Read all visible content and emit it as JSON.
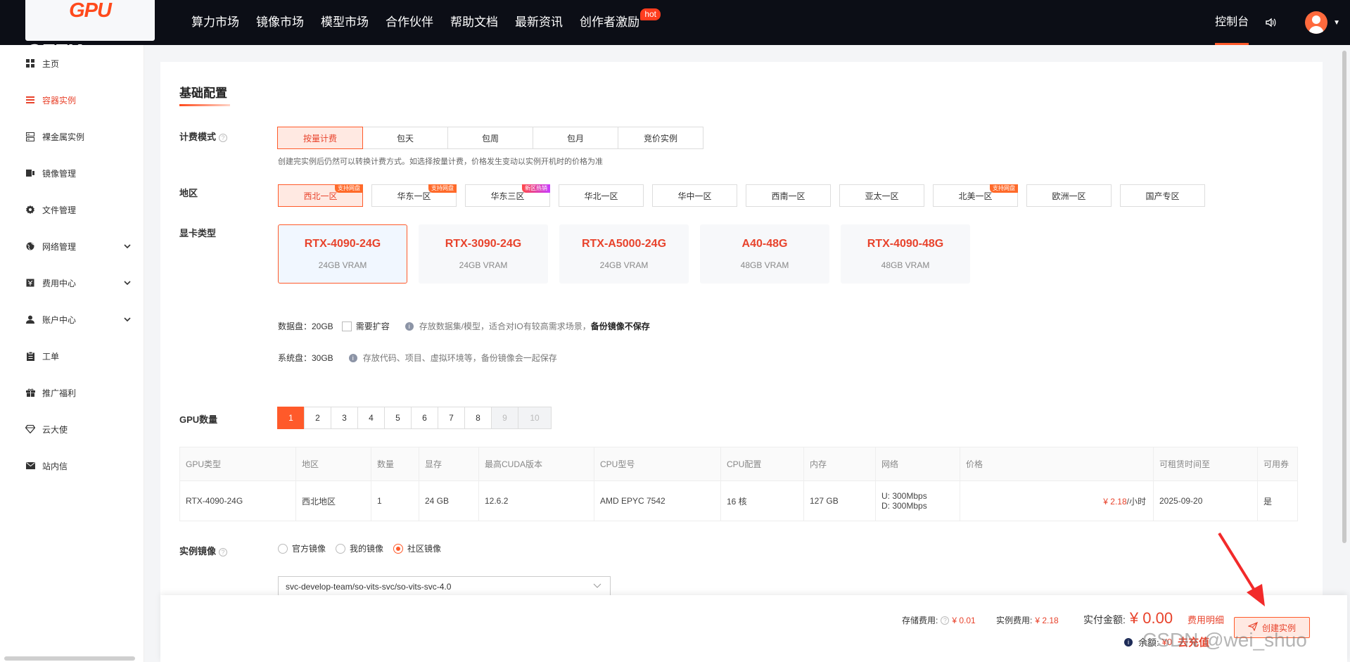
{
  "header": {
    "logo_a": "GPU",
    "logo_b": "GEEK",
    "logo_dot": ".",
    "nav": [
      "算力市场",
      "镜像市场",
      "模型市场",
      "合作伙伴",
      "帮助文档",
      "最新资讯",
      "创作者激励"
    ],
    "hot_badge": "hot",
    "console": "控制台"
  },
  "sidebar": {
    "items": [
      {
        "label": "主页",
        "icon": "grid-icon"
      },
      {
        "label": "容器实例",
        "icon": "list-icon",
        "active": true
      },
      {
        "label": "裸金属实例",
        "icon": "server-icon"
      },
      {
        "label": "镜像管理",
        "icon": "image-icon"
      },
      {
        "label": "文件管理",
        "icon": "gear-icon"
      },
      {
        "label": "网络管理",
        "icon": "globe-icon",
        "expand": true
      },
      {
        "label": "费用中心",
        "icon": "wallet-icon",
        "expand": true
      },
      {
        "label": "账户中心",
        "icon": "user-icon",
        "expand": true
      },
      {
        "label": "工单",
        "icon": "clipboard-icon"
      },
      {
        "label": "推广福利",
        "icon": "gift-icon"
      },
      {
        "label": "云大使",
        "icon": "diamond-icon"
      },
      {
        "label": "站内信",
        "icon": "mail-icon"
      }
    ]
  },
  "config": {
    "title": "基础配置",
    "billing": {
      "label": "计费模式",
      "options": [
        "按量计费",
        "包天",
        "包周",
        "包月",
        "竞价实例"
      ],
      "selected": 0,
      "hint": "创建完实例后仍然可以转换计费方式。如选择按量计费，价格发生变动以实例开机时的价格为准"
    },
    "region": {
      "label": "地区",
      "options": [
        {
          "name": "西北一区",
          "tag": "支持网盘",
          "sel": true
        },
        {
          "name": "华东一区",
          "tag": "支持网盘"
        },
        {
          "name": "华东三区",
          "tag": "新区热销",
          "purple": true
        },
        {
          "name": "华北一区"
        },
        {
          "name": "华中一区"
        },
        {
          "name": "西南一区"
        },
        {
          "name": "亚太一区"
        },
        {
          "name": "北美一区",
          "tag": "支持网盘"
        },
        {
          "name": "欧洲一区"
        },
        {
          "name": "国产专区"
        }
      ]
    },
    "gpu": {
      "label": "显卡类型",
      "cards": [
        {
          "name": "RTX-4090-24G",
          "vram": "24GB VRAM",
          "sel": true
        },
        {
          "name": "RTX-3090-24G",
          "vram": "24GB VRAM"
        },
        {
          "name": "RTX-A5000-24G",
          "vram": "24GB VRAM"
        },
        {
          "name": "A40-48G",
          "vram": "48GB VRAM"
        },
        {
          "name": "RTX-4090-48G",
          "vram": "48GB VRAM"
        }
      ]
    },
    "data_disk": {
      "label": "数据盘：20GB",
      "expand": "需要扩容",
      "note": "存放数据集/模型，适合对IO有较高需求场景，",
      "note_bold": "备份镜像不保存"
    },
    "sys_disk": {
      "label": "系统盘：30GB",
      "note": "存放代码、项目、虚拟环境等，备份镜像会一起保存"
    },
    "gpu_count": {
      "label": "GPU数量",
      "options": [
        "1",
        "2",
        "3",
        "4",
        "5",
        "6",
        "7",
        "8",
        "9",
        "10"
      ],
      "selected": "1",
      "disabled": [
        "9",
        "10"
      ]
    },
    "table": {
      "headers": [
        "GPU类型",
        "地区",
        "数量",
        "显存",
        "最高CUDA版本",
        "CPU型号",
        "CPU配置",
        "内存",
        "网络",
        "价格",
        "可租赁时间至",
        "可用券"
      ],
      "row": {
        "gpu": "RTX-4090-24G",
        "region": "西北地区",
        "count": "1",
        "vram": "24 GB",
        "cuda": "12.6.2",
        "cpu": "AMD EPYC 7542",
        "cpu_cfg": "16 核",
        "mem": "127 GB",
        "net_up": "U: 300Mbps",
        "net_down": "D: 300Mbps",
        "price": "¥ 2.18",
        "price_unit": "/小时",
        "until": "2025-09-20",
        "coupon": "是"
      }
    },
    "image": {
      "label": "实例镜像",
      "options": [
        "官方镜像",
        "我的镜像",
        "社区镜像"
      ],
      "selected": "社区镜像",
      "value": "svc-develop-team/so-vits-svc/so-vits-svc-4.0"
    }
  },
  "footer": {
    "storage_label": "存储费用:",
    "storage_amt": "¥ 0.01",
    "instance_label": "实例费用:",
    "instance_amt": "¥ 2.18",
    "total_label": "实付金额:",
    "total_amt": "¥ 0.00",
    "detail": "费用明细",
    "create": "创建实例",
    "balance_label": "余额:",
    "balance_amt": "¥0",
    "recharge": "去充值"
  },
  "watermark": "CSDN @wei_shuo",
  "colors": {
    "accent": "#ff5a2a",
    "text_red": "#e8432c",
    "topbar": "#0c0e16"
  }
}
